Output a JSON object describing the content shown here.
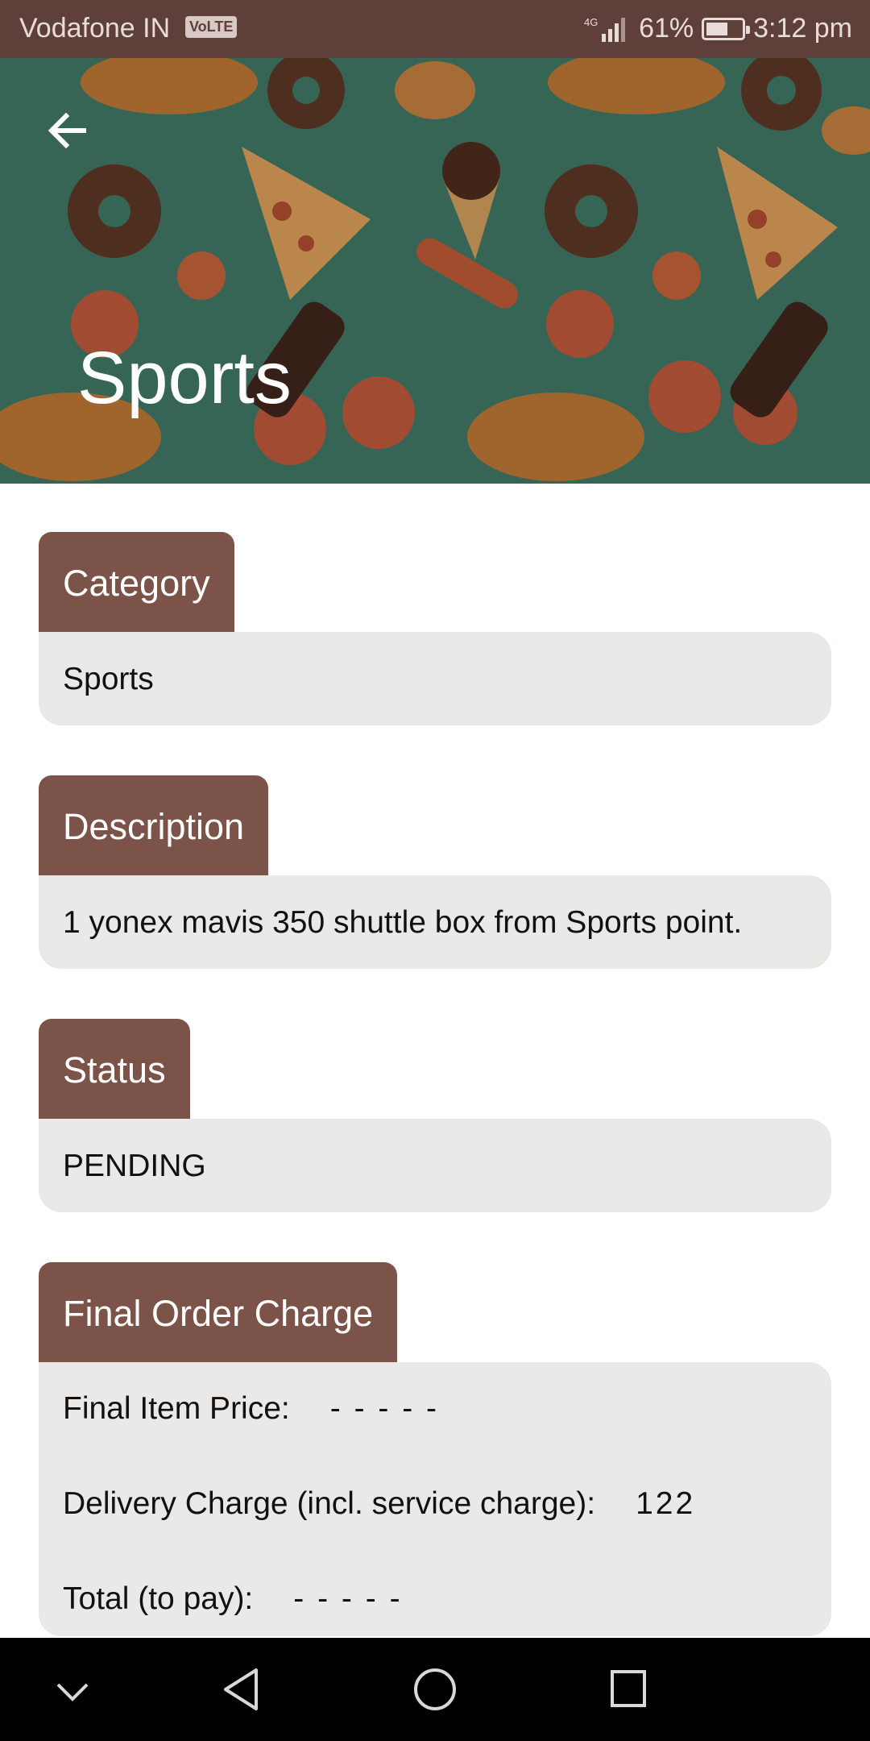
{
  "status_bar": {
    "carrier": "Vodafone IN",
    "volte": "VoLTE",
    "network": "4G",
    "battery": "61%",
    "battery_level": 0.61,
    "time": "3:12 pm"
  },
  "header": {
    "title": "Sports",
    "back_icon": "arrow-left-icon",
    "background_icon": "food-pattern"
  },
  "sections": [
    {
      "label": "Category",
      "value": "Sports"
    },
    {
      "label": "Description",
      "value": "1 yonex mavis 350 shuttle box from Sports point."
    },
    {
      "label": "Status",
      "value": "PENDING"
    },
    {
      "label": "Final Order Charge",
      "rows": [
        {
          "key": "Final Item Price:",
          "value": "- - - - -"
        },
        {
          "key": "Delivery Charge (incl. service charge):",
          "value": "122"
        },
        {
          "key": "Total (to pay):",
          "value": "- - - - -"
        }
      ]
    }
  ],
  "nav_bar": {
    "icons": [
      "chevron-down-icon",
      "back-triangle-icon",
      "home-circle-icon",
      "recents-square-icon"
    ]
  },
  "colors": {
    "status_bar": "#5e3f39",
    "header_bg": "#3d7a68",
    "label_bg": "#7b5348",
    "value_bg": "#ebe9e7"
  }
}
